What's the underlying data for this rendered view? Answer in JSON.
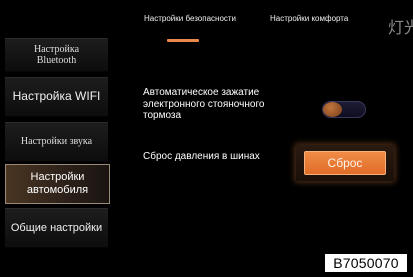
{
  "sidebar": {
    "items": [
      {
        "label": "Настройка\nBluetooth",
        "selected": false
      },
      {
        "label": "Настройка WIFI",
        "selected": false
      },
      {
        "label": "Настройки звука",
        "selected": false
      },
      {
        "label": "Настройки\nавтомобиля",
        "selected": true
      },
      {
        "label": "Общие настройки",
        "selected": false
      }
    ]
  },
  "tabs": [
    {
      "label": "Настройки безопасности",
      "active": true
    },
    {
      "label": "Настройки комфорта",
      "active": false
    },
    {
      "label": "灯光",
      "active": false
    }
  ],
  "settings": {
    "epb_auto": {
      "label": "Автоматическое зажатие\nэлектронного стояночного\nтормоза",
      "toggle_on": false
    },
    "tpms_reset": {
      "label": "Сброс давления в шинах",
      "button_label": "Сброс"
    }
  },
  "figure_code": "B7050070",
  "colors": {
    "accent": "#e8884a",
    "background": "#000000",
    "toggle_track": "#1e1c36"
  }
}
